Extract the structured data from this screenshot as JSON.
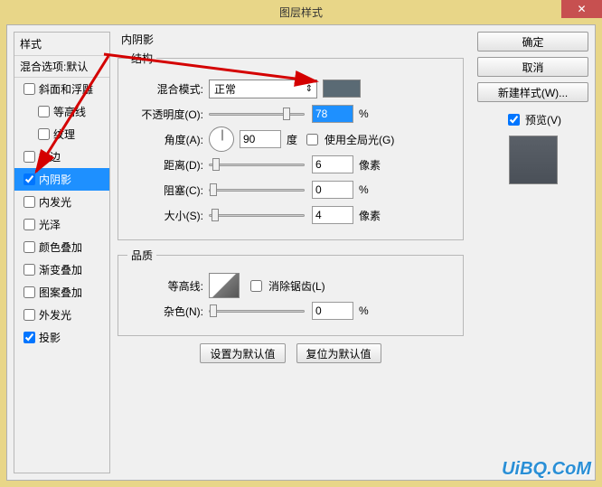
{
  "window": {
    "title": "图层样式",
    "close": "✕"
  },
  "styles": {
    "header": "样式",
    "blend_default": "混合选项:默认",
    "items": [
      {
        "label": "斜面和浮雕",
        "checked": false
      },
      {
        "label": "等高线",
        "checked": false,
        "indent": true
      },
      {
        "label": "纹理",
        "checked": false,
        "indent": true
      },
      {
        "label": "描边",
        "checked": false
      },
      {
        "label": "内阴影",
        "checked": true,
        "selected": true
      },
      {
        "label": "内发光",
        "checked": false
      },
      {
        "label": "光泽",
        "checked": false
      },
      {
        "label": "颜色叠加",
        "checked": false
      },
      {
        "label": "渐变叠加",
        "checked": false
      },
      {
        "label": "图案叠加",
        "checked": false
      },
      {
        "label": "外发光",
        "checked": false
      },
      {
        "label": "投影",
        "checked": true
      }
    ]
  },
  "panel": {
    "title": "内阴影",
    "structure_legend": "结构",
    "blend_mode_label": "混合模式:",
    "blend_mode_value": "正常",
    "opacity_label": "不透明度(O):",
    "opacity_value": "78",
    "opacity_unit": "%",
    "angle_label": "角度(A):",
    "angle_value": "90",
    "angle_unit": "度",
    "global_light": "使用全局光(G)",
    "distance_label": "距离(D):",
    "distance_value": "6",
    "distance_unit": "像素",
    "choke_label": "阻塞(C):",
    "choke_value": "0",
    "choke_unit": "%",
    "size_label": "大小(S):",
    "size_value": "4",
    "size_unit": "像素",
    "quality_legend": "品质",
    "contour_label": "等高线:",
    "antialias": "消除锯齿(L)",
    "noise_label": "杂色(N):",
    "noise_value": "0",
    "noise_unit": "%",
    "set_default": "设置为默认值",
    "reset_default": "复位为默认值"
  },
  "right": {
    "ok": "确定",
    "cancel": "取消",
    "new_style": "新建样式(W)...",
    "preview": "预览(V)"
  },
  "watermark": "UiBQ.CoM",
  "colors": {
    "shadow_swatch": "#5a6a74"
  }
}
